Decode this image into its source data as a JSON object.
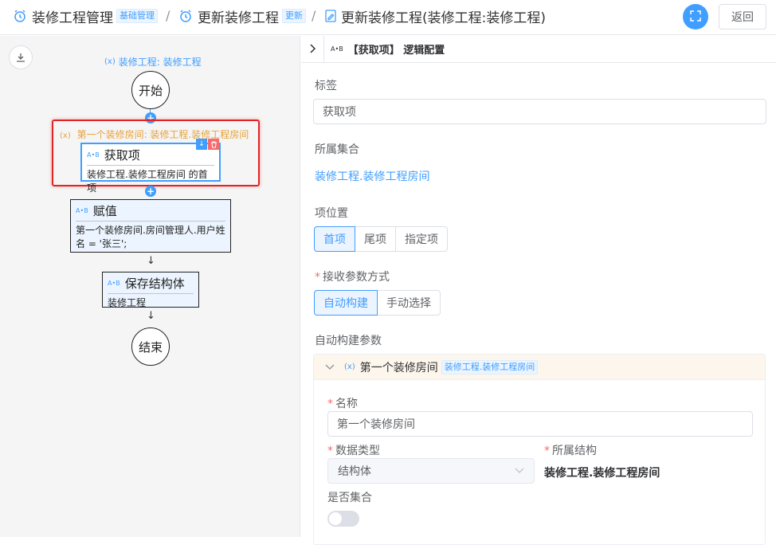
{
  "breadcrumb": {
    "items": [
      {
        "label": "装修工程管理",
        "tag": "基础管理"
      },
      {
        "label": "更新装修工程",
        "tag": "更新"
      },
      {
        "label": "更新装修工程(装修工程:装修工程)"
      }
    ],
    "separator": "/"
  },
  "header": {
    "back_label": "返回"
  },
  "flow": {
    "root_variable": "装修工程: 装修工程",
    "start_label": "开始",
    "end_label": "结束",
    "loop_label": "第一个装修房间: 装修工程.装修工程房间",
    "nodes": [
      {
        "badge": "A•B",
        "title": "获取项",
        "desc": "装修工程.装修工程房间 的首项"
      },
      {
        "badge": "A•B",
        "title": "赋值",
        "desc": "第一个装修房间.房间管理人.用户姓名 = '张三';"
      },
      {
        "badge": "A•B",
        "title": "保存结构体",
        "desc": "装修工程"
      }
    ],
    "var_icon": "x-variable-icon"
  },
  "panel": {
    "badge": "A•B",
    "title": "【获取项】 逻辑配置",
    "tag_label": "标签",
    "tag_value": "获取项",
    "collection_label": "所属集合",
    "collection_value": "装修工程.装修工程房间",
    "position_label": "项位置",
    "position_options": [
      "首项",
      "尾项",
      "指定项"
    ],
    "position_selected": "首项",
    "receive_label": "接收参数方式",
    "receive_options": [
      "自动构建",
      "手动选择"
    ],
    "receive_selected": "自动构建",
    "auto_params_label": "自动构建参数",
    "param": {
      "name": "第一个装修房间",
      "type_tag": "装修工程.装修工程房间",
      "name_label": "名称",
      "name_value": "第一个装修房间",
      "data_type_label": "数据类型",
      "data_type_value": "结构体",
      "structure_label": "所属结构",
      "structure_value": "装修工程.装修工程房间",
      "is_collection_label": "是否集合",
      "is_collection": false
    }
  },
  "colors": {
    "primary": "#409eff",
    "danger": "#e02424",
    "warning": "#e6a23c"
  }
}
